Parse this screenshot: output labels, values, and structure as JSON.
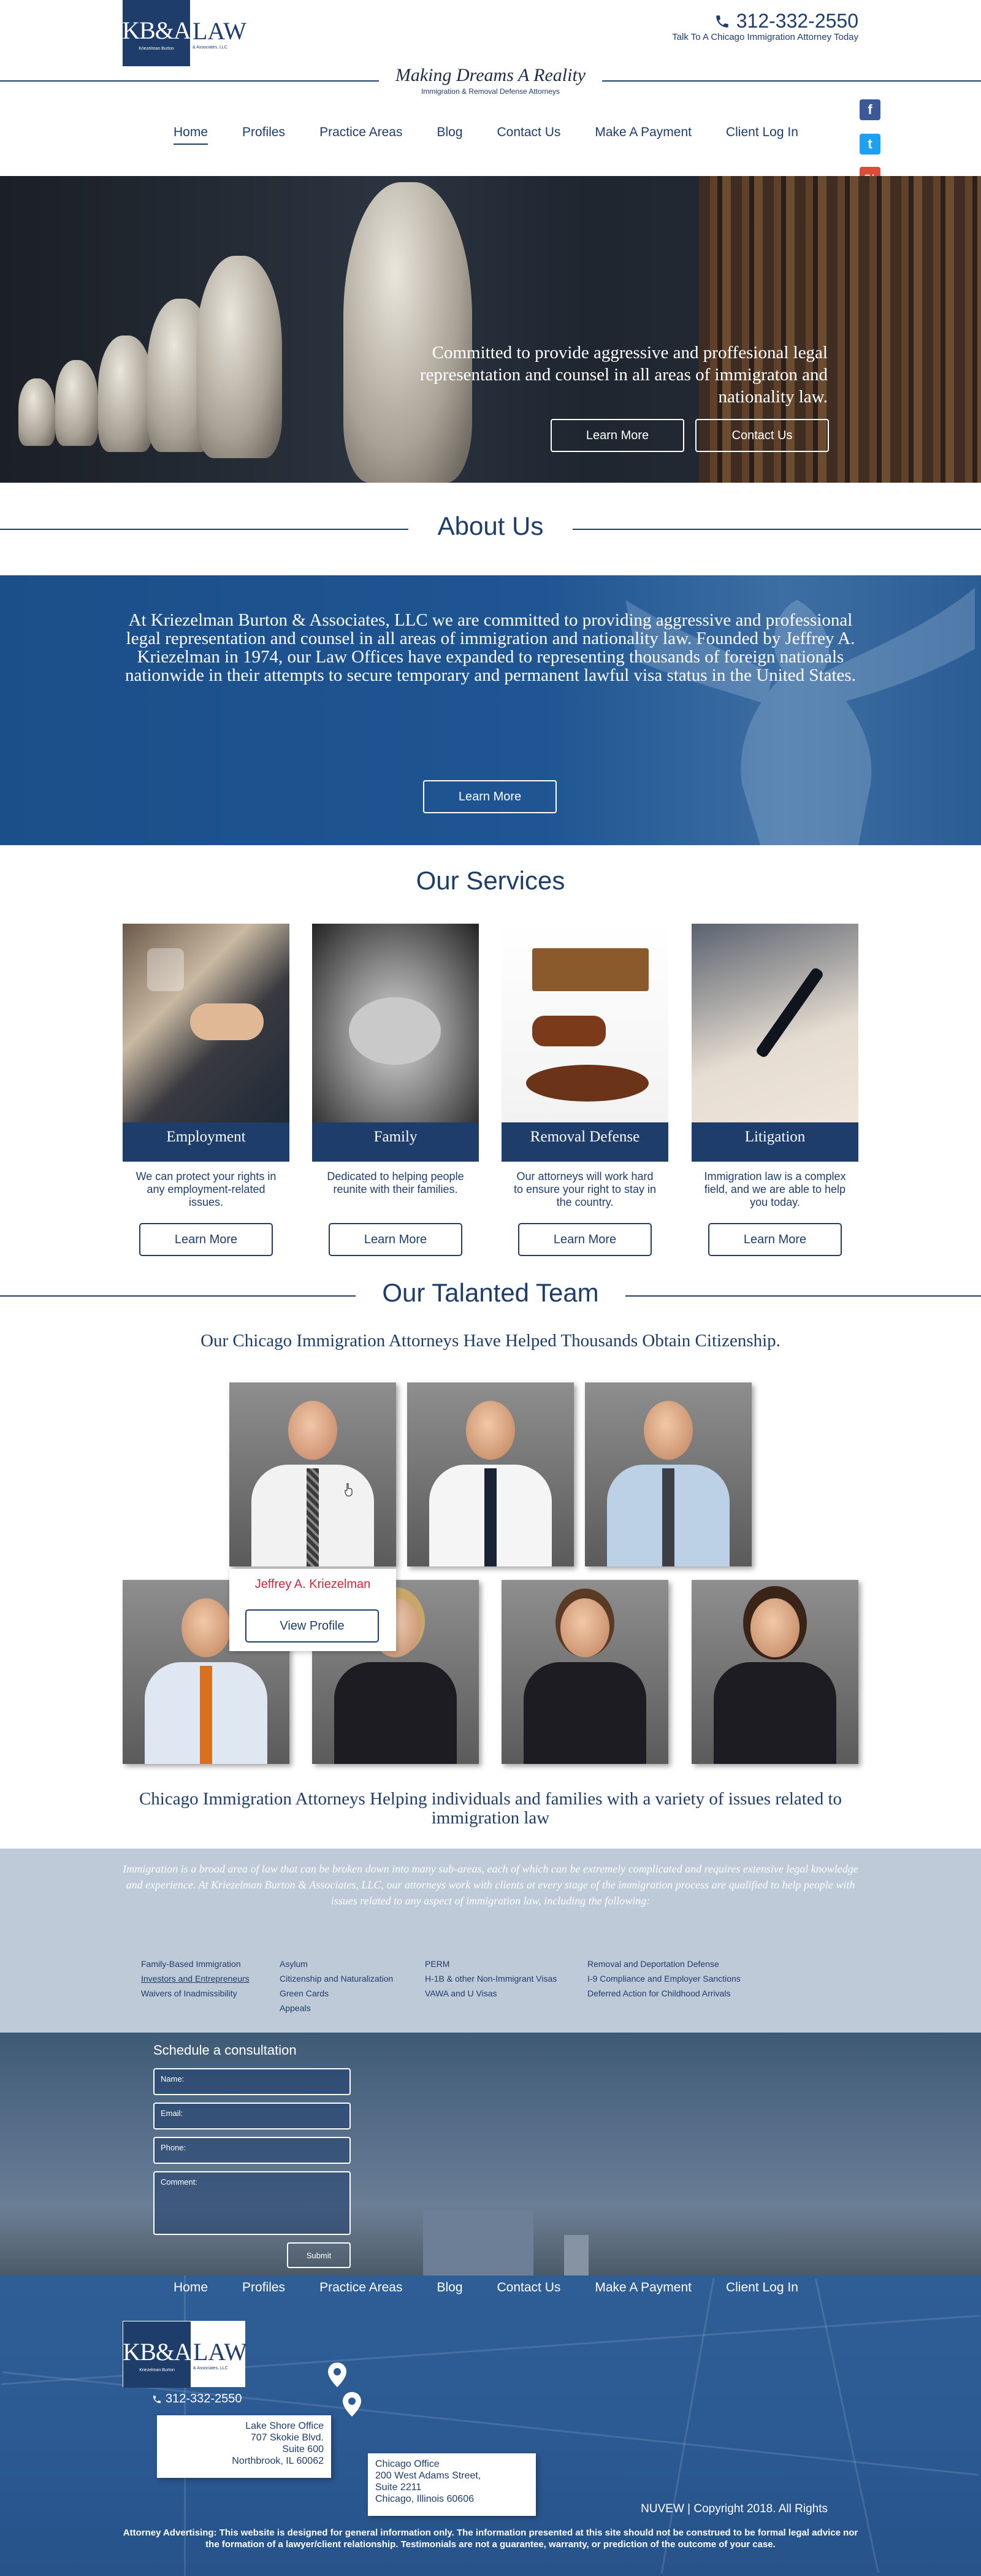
{
  "brand": {
    "logo_left_big": "KB&A",
    "logo_left_small": "Kriezelman Burton",
    "logo_right_big": "LAW",
    "logo_right_small": "& Associates, LLC",
    "color_primary": "#1e3d6b",
    "color_accent": "#d0263e"
  },
  "header": {
    "phone_icon": "phone-icon",
    "phone": "312-332-2550",
    "phone_sub": "Talk To A Chicago Immigration Attorney Today",
    "tagline": "Making Dreams A Reality",
    "tagline_sub": "Immigration & Removal Defense Attorneys"
  },
  "nav": {
    "items": [
      {
        "label": "Home",
        "active": true
      },
      {
        "label": "Profiles"
      },
      {
        "label": "Practice Areas"
      },
      {
        "label": "Blog"
      },
      {
        "label": "Contact Us"
      },
      {
        "label": "Make A Payment"
      },
      {
        "label": "Client Log In"
      }
    ]
  },
  "social": {
    "facebook": "f",
    "twitter": "t",
    "google": "g+"
  },
  "hero": {
    "text": "Committed to provide aggressive and proffesional legal representation and counsel in all areas of immigraton and nationality law.",
    "btn_learn": "Learn More",
    "btn_contact": "Contact Us"
  },
  "about": {
    "title": "About Us",
    "text": "At Kriezelman Burton & Associates, LLC we are committed to providing aggressive and professional legal representation and counsel in all areas of immigration and nationality law. Founded by Jeffrey A. Kriezelman in 1974, our Law Offices have expanded to representing thousands of foreign nationals nationwide in their attempts to secure temporary and permanent lawful visa status in the United States.",
    "btn": "Learn More"
  },
  "services": {
    "title": "Our Services",
    "cards": [
      {
        "name": "Employment",
        "desc": "We can protect your rights in any employment-related issues.",
        "btn": "Learn More"
      },
      {
        "name": "Family",
        "desc": "Dedicated to helping people reunite with their families.",
        "btn": "Learn More"
      },
      {
        "name": "Removal Defense",
        "desc": "Our attorneys will work hard to ensure your right to stay in the country.",
        "btn": "Learn More"
      },
      {
        "name": "Litigation",
        "desc": "Immigration law is a complex field, and we are able to help you today.",
        "btn": "Learn More"
      }
    ]
  },
  "team": {
    "title": "Our Talanted Team",
    "subtitle": "Our Chicago Immigration Attorneys Have Helped Thousands Obtain Citizenship.",
    "hover_name": "Jeffrey A. Kriezelman",
    "hover_btn": "View Profile",
    "closing": "Chicago Immigration Attorneys Helping individuals and families with a variety of issues related to immigration law"
  },
  "practice": {
    "intro": "Immigration is a broad area of law that can be broken down into many sub-areas, each of which can be extremely complicated and requires extensive legal knowledge and experience. At Kriezelman Burton & Associates, LLC, our attorneys work with clients at every stage of the immigration process are qualified to help people with issues related to any aspect of immigration law, including the following:",
    "col1": [
      "Family-Based Immigration",
      "Investors and Entrepreneurs",
      "Waivers of Inadmissibility"
    ],
    "col2": [
      "Asylum",
      "Citizenship and Naturalization",
      "Green Cards",
      "Appeals"
    ],
    "col3": [
      "PERM",
      "H-1B & other Non-Immigrant Visas",
      "VAWA and U Visas"
    ],
    "col4": [
      "Removal and Deportation Defense",
      "I-9 Compliance and Employer Sanctions",
      "Deferred Action for Childhood Arrivals"
    ]
  },
  "consult": {
    "title": "Schedule a consultation",
    "name": "Name:",
    "email": "Email:",
    "phone": "Phone:",
    "comment": "Comment:",
    "submit": "Submit"
  },
  "footer": {
    "nav": [
      "Home",
      "Profiles",
      "Practice Areas",
      "Blog",
      "Contact Us",
      "Make A Payment",
      "Client Log In"
    ],
    "phone": "312-332-2550",
    "office1": [
      "Lake Shore Office",
      "707 Skokie Blvd.",
      "Suite 600",
      "Northbrook, IL 60062"
    ],
    "office2": [
      "Chicago Office",
      "200 West Adams Street,",
      "Suite 2211",
      "Chicago, Illinois 60606"
    ],
    "copyright": "NUVEW | Copyright 2018. All Rights",
    "disclaimer": "Attorney Advertising: This website is designed for general information only. The information presented at this site should not be construed to be formal legal advice nor the formation of a lawyer/client relationship. Testimonials are not a guarantee, warranty, or prediction of the outcome of your case."
  }
}
